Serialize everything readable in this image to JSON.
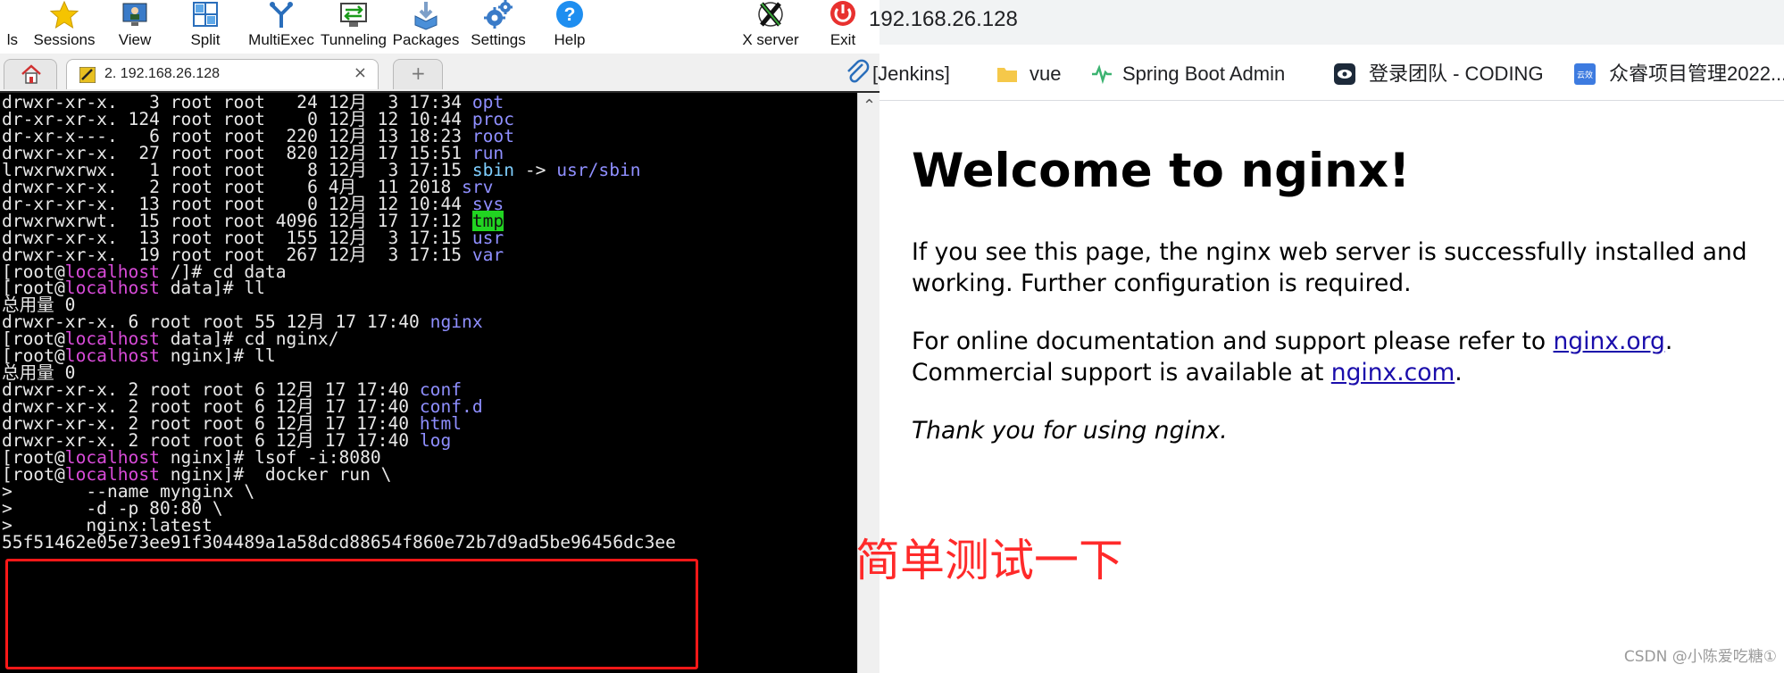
{
  "toolbar": {
    "partial_label": "ls",
    "sessions": "Sessions",
    "view": "View",
    "split": "Split",
    "multiexec": "MultiExec",
    "tunneling": "Tunneling",
    "packages": "Packages",
    "settings": "Settings",
    "help": "Help",
    "xserver": "X server",
    "exit": "Exit"
  },
  "tabs": {
    "session_label": "2. 192.168.26.128",
    "close": "×",
    "new_tab": "+"
  },
  "terminal": {
    "lines": [
      {
        "text": "drwxr-xr-x.   3 root root   24 12月  3 17:34 ",
        "name": "opt"
      },
      {
        "text": "dr-xr-xr-x. 124 root root    0 12月 12 10:44 ",
        "name": "proc"
      },
      {
        "text": "dr-xr-x---.   6 root root  220 12月 13 18:23 ",
        "name": "root"
      },
      {
        "text": "drwxr-xr-x.  27 root root  820 12月 17 15:51 ",
        "name": "run"
      },
      {
        "text": "lrwxrwxrwx.   1 root root    8 12月  3 17:15 ",
        "name": "sbin",
        "arrow": " -> ",
        "target": "usr/sbin"
      },
      {
        "text": "drwxr-xr-x.   2 root root    6 4月  11 2018 ",
        "name": "srv"
      },
      {
        "text": "dr-xr-xr-x.  13 root root    0 12月 12 10:44 ",
        "name": "sys"
      },
      {
        "text": "drwxrwxrwt.  15 root root 4096 12月 17 17:12 ",
        "name": "tmp"
      },
      {
        "text": "drwxr-xr-x.  13 root root  155 12月  3 17:15 ",
        "name": "usr"
      },
      {
        "text": "drwxr-xr-x.  19 root root  267 12月  3 17:15 ",
        "name": "var"
      },
      {
        "prompt_dir": "/",
        "cmd": " cd data"
      },
      {
        "prompt_dir": "data",
        "cmd": " ll"
      },
      {
        "plain": "总用量 0"
      },
      {
        "text": "drwxr-xr-x. 6 root root 55 12月 17 17:40 ",
        "name": "nginx"
      },
      {
        "prompt_dir": "data",
        "cmd": " cd nginx/"
      },
      {
        "prompt_dir": "nginx",
        "cmd": " ll"
      },
      {
        "plain": "总用量 0"
      },
      {
        "text": "drwxr-xr-x. 2 root root 6 12月 17 17:40 ",
        "name": "conf"
      },
      {
        "text": "drwxr-xr-x. 2 root root 6 12月 17 17:40 ",
        "name": "conf.d"
      },
      {
        "text": "drwxr-xr-x. 2 root root 6 12月 17 17:40 ",
        "name": "html"
      },
      {
        "text": "drwxr-xr-x. 2 root root 6 12月 17 17:40 ",
        "name": "log"
      },
      {
        "prompt_dir": "nginx",
        "cmd": " lsof -i:8080"
      },
      {
        "prompt_dir": "nginx",
        "cmd": "  docker run \\"
      },
      {
        "plain": ">       --name mynginx \\"
      },
      {
        "plain": ">       -d -p 80:80 \\"
      },
      {
        "plain": ">       nginx:latest"
      },
      {
        "plain": "55f51462e05e73ee91f304489a1a58dcd88654f860e72b7d9ad5be96456dc3ee"
      }
    ],
    "prompt_user": "root",
    "prompt_host": "localhost"
  },
  "browser": {
    "url": "192.168.26.128",
    "bookmarks": [
      "[Jenkins]",
      "vue",
      "Spring Boot Admin",
      "登录团队 - CODING",
      "众睿项目管理2022..."
    ],
    "heading": "Welcome to nginx!",
    "p1_line1": "If you see this page, the nginx web server is successfully installed and",
    "p1_line2": "working. Further configuration is required.",
    "p2_line1_pre": "For online documentation and support please refer to ",
    "p2_link1": "nginx.org",
    "p2_line1_post": ".",
    "p2_line2_pre": "Commercial support is available at ",
    "p2_link2": "nginx.com",
    "p2_line2_post": ".",
    "p3": "Thank you for using nginx."
  },
  "annotation": "简单测试一下",
  "watermark": "CSDN @小陈爱吃糖①",
  "colors": {
    "terminal_bg": "#000000",
    "dir_blue": "#8f8fff",
    "host_magenta": "#d94bd9",
    "tmp_highlight": "#21d421",
    "annotation_red": "#ff2a2a",
    "link_blue": "#1a0dab"
  },
  "icons": {
    "sessions": "star-icon",
    "view": "monitor-icon",
    "split": "split-icon",
    "multiexec": "fork-icon",
    "tunneling": "tunnel-icon",
    "packages": "package-icon",
    "settings": "gear-icon",
    "help": "help-icon",
    "xserver": "x-logo-icon",
    "exit": "power-icon"
  }
}
